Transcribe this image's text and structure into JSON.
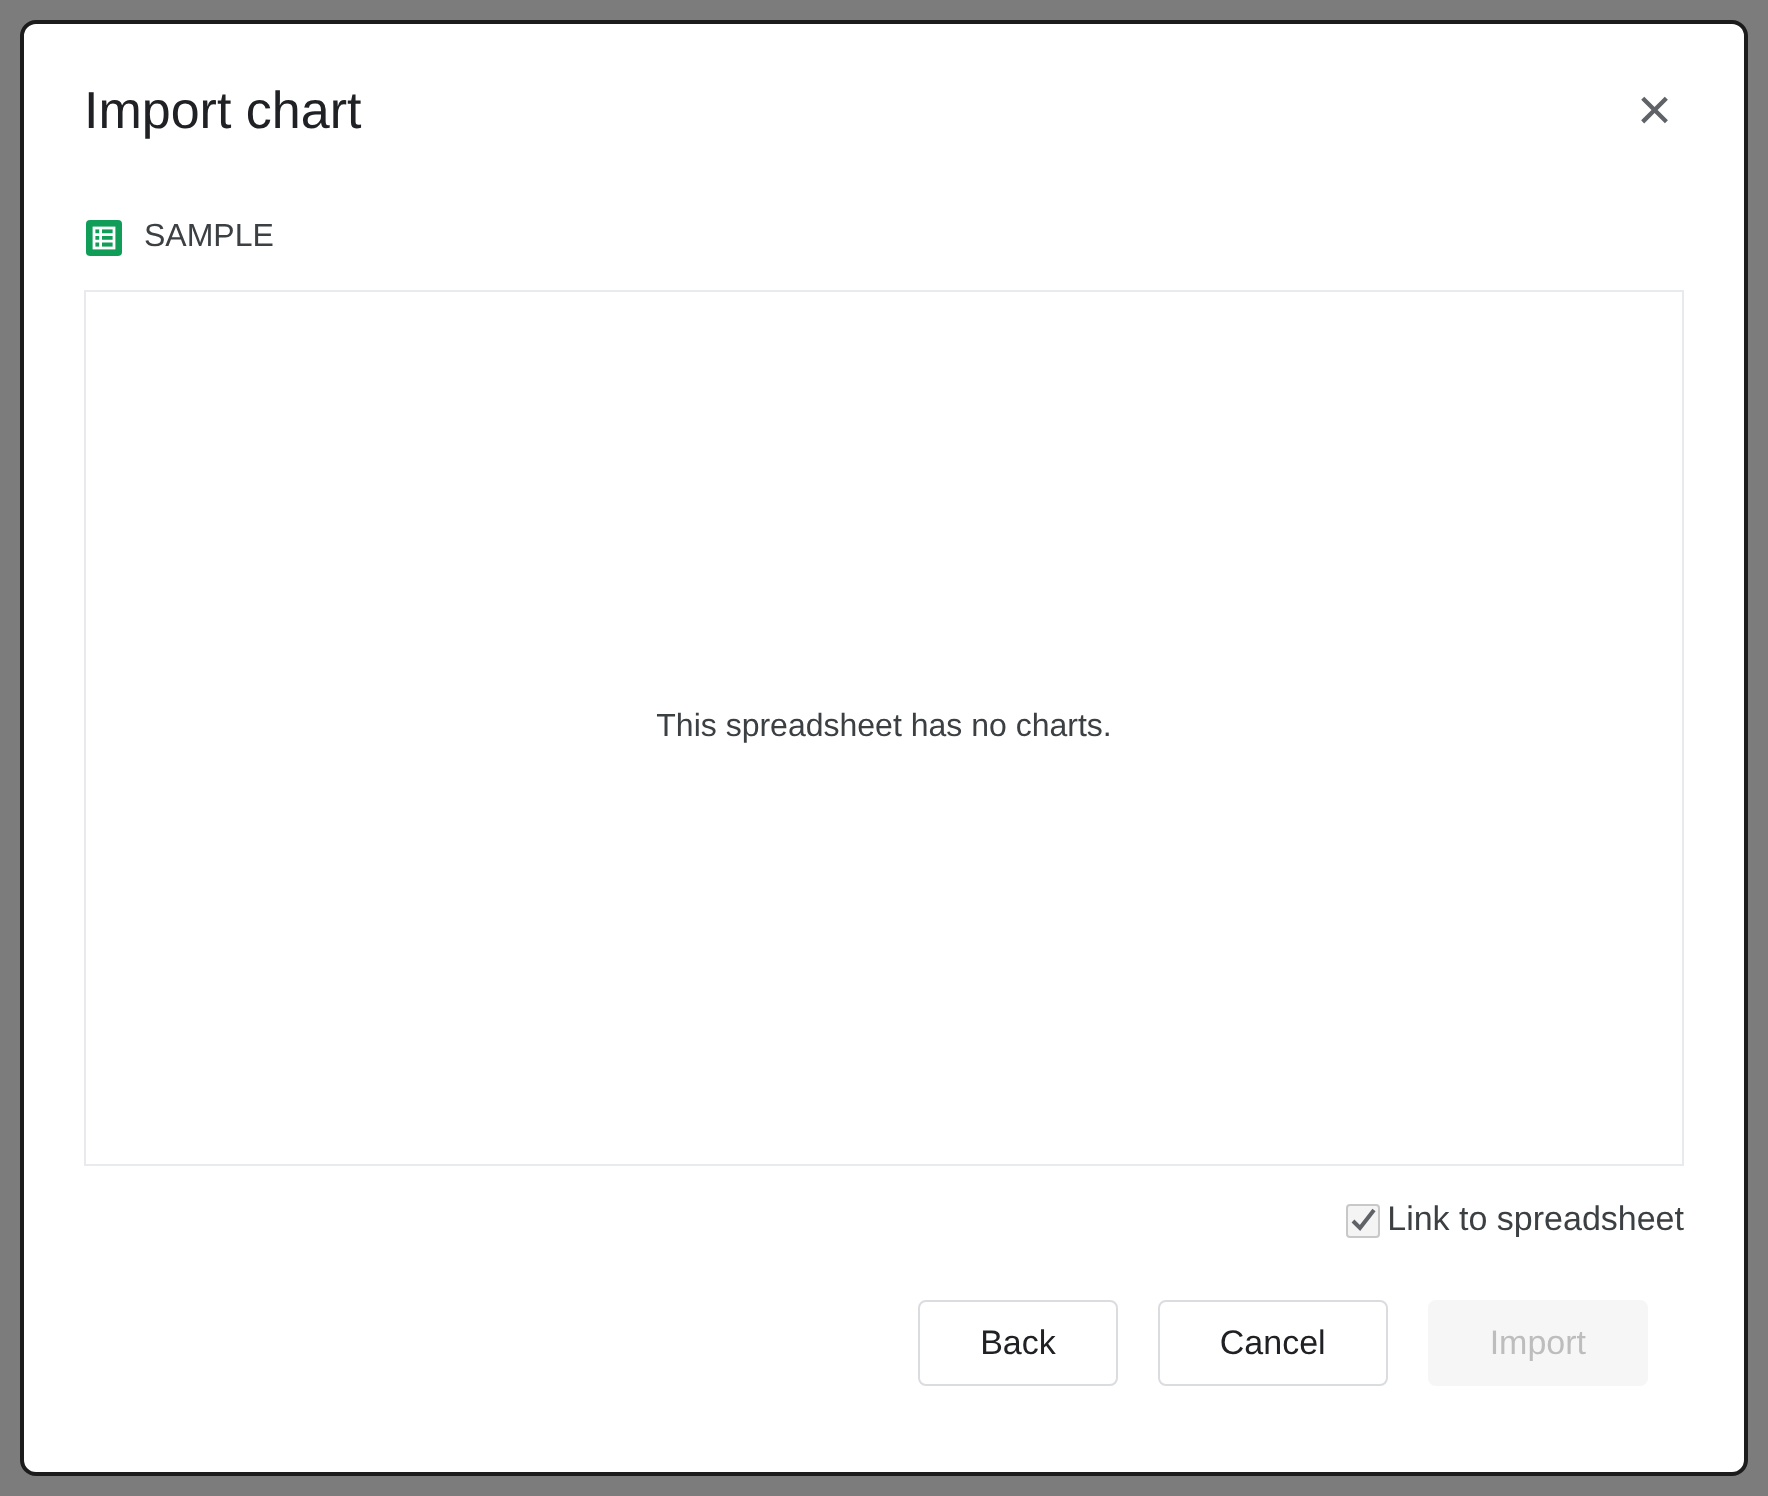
{
  "dialog": {
    "title": "Import chart",
    "close": "×"
  },
  "spreadsheet": {
    "name": "SAMPLE"
  },
  "preview": {
    "message": "This spreadsheet has no charts."
  },
  "link_option": {
    "label": "Link to spreadsheet",
    "checked": true
  },
  "buttons": [
    {
      "label": "Back",
      "disabled": false
    },
    {
      "label": "Cancel",
      "disabled": false
    },
    {
      "label": "Import",
      "disabled": true
    }
  ]
}
